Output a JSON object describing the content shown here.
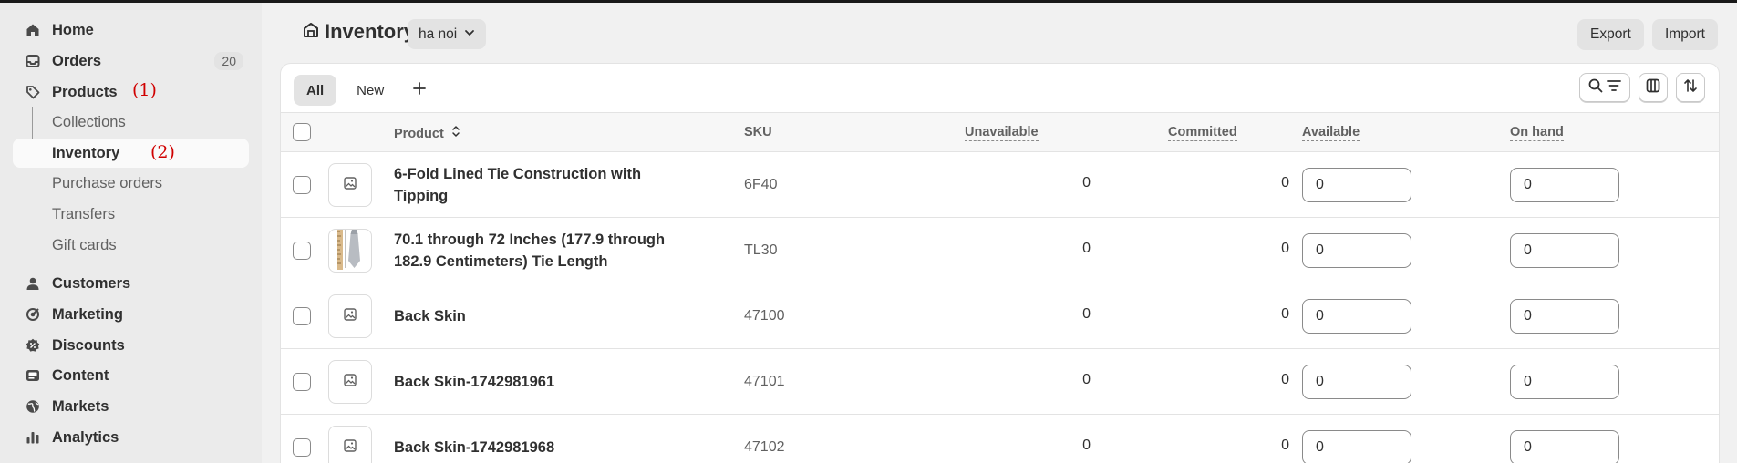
{
  "sidebar": {
    "items": [
      {
        "label": "Home",
        "icon": "home-icon"
      },
      {
        "label": "Orders",
        "icon": "inbox-icon",
        "badge": "20"
      },
      {
        "label": "Products",
        "icon": "tag-icon"
      },
      {
        "label": "Collections"
      },
      {
        "label": "Inventory"
      },
      {
        "label": "Purchase orders"
      },
      {
        "label": "Transfers"
      },
      {
        "label": "Gift cards"
      },
      {
        "label": "Customers",
        "icon": "person-icon"
      },
      {
        "label": "Marketing",
        "icon": "target-icon"
      },
      {
        "label": "Discounts",
        "icon": "discount-icon"
      },
      {
        "label": "Content",
        "icon": "content-icon"
      },
      {
        "label": "Markets",
        "icon": "globe-icon"
      },
      {
        "label": "Analytics",
        "icon": "bar-chart-icon"
      }
    ],
    "annotations": [
      "(1)",
      "(2)"
    ]
  },
  "header": {
    "title": "Inventory",
    "location": "ha noi",
    "export_label": "Export",
    "import_label": "Import"
  },
  "tabs": [
    "All",
    "New"
  ],
  "table": {
    "columns": {
      "product": "Product",
      "sku": "SKU",
      "unavailable": "Unavailable",
      "committed": "Committed",
      "available": "Available",
      "on_hand": "On hand"
    },
    "rows": [
      {
        "product": "6-Fold Lined Tie Construction with Tipping",
        "sku": "6F40",
        "unavailable": "0",
        "committed": "0",
        "available": "0",
        "on_hand": "0"
      },
      {
        "product": "70.1 through 72 Inches (177.9 through 182.9 Centimeters) Tie Length",
        "sku": "TL30",
        "unavailable": "0",
        "committed": "0",
        "available": "0",
        "on_hand": "0"
      },
      {
        "product": "Back Skin",
        "sku": "47100",
        "unavailable": "0",
        "committed": "0",
        "available": "0",
        "on_hand": "0"
      },
      {
        "product": "Back Skin-1742981961",
        "sku": "47101",
        "unavailable": "0",
        "committed": "0",
        "available": "0",
        "on_hand": "0"
      },
      {
        "product": "Back Skin-1742981968",
        "sku": "47102",
        "unavailable": "0",
        "committed": "0",
        "available": "0",
        "on_hand": "0"
      }
    ]
  },
  "colors": {
    "sidebar_bg": "#ebebeb",
    "page_bg": "#f1f1f1",
    "annotation": "#d00000"
  }
}
